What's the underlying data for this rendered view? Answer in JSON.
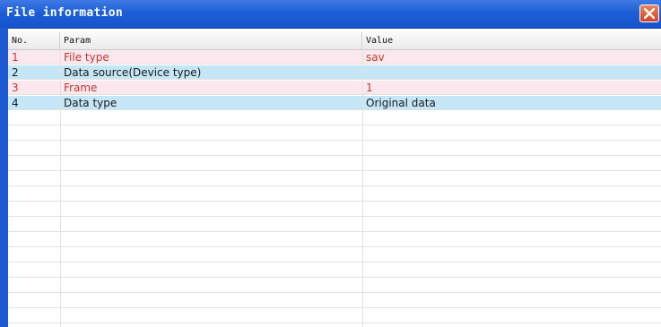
{
  "window": {
    "title": "File information"
  },
  "table": {
    "headers": [
      "No.",
      "Param",
      "Value"
    ],
    "rows": [
      {
        "no": "1",
        "param": "File type",
        "value": "sav"
      },
      {
        "no": "2",
        "param": "Data source(Device type)",
        "value": ""
      },
      {
        "no": "3",
        "param": "Frame",
        "value": "1"
      },
      {
        "no": "4",
        "param": "Data type",
        "value": "Original data"
      }
    ]
  },
  "colors": {
    "title_bar": "#1d5fd8",
    "row_odd": "#fbe8ef",
    "row_even": "#c4e6f7",
    "text_odd": "#c0392b",
    "text_even": "#1a1a1a",
    "close_button": "#d4431f"
  },
  "icons": {
    "close": "close-icon"
  }
}
